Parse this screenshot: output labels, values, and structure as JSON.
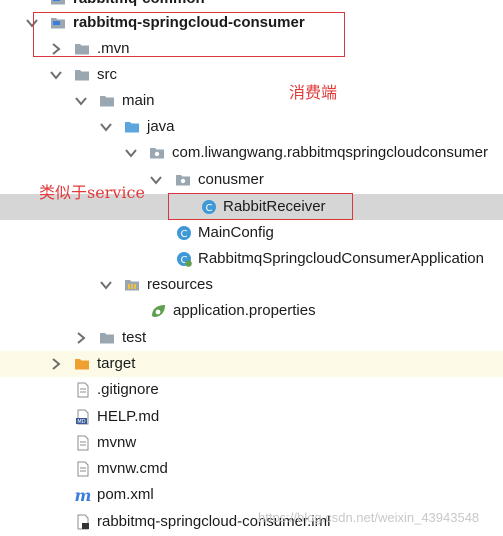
{
  "tree": {
    "top_cut_label": "rabbitmq-common",
    "project_label": "rabbitmq-springcloud-consumer",
    "mvn_label": ".mvn",
    "src_label": "src",
    "main_label": "main",
    "java_label": "java",
    "package_label": "com.liwangwang.rabbitmqspringcloudconsumer",
    "conusmer_label": "conusmer",
    "rabbit_receiver_label": "RabbitReceiver",
    "mainconfig_label": "MainConfig",
    "application_label": "RabbitmqSpringcloudConsumerApplication",
    "resources_label": "resources",
    "properties_label": "application.properties",
    "test_label": "test",
    "target_label": "target",
    "gitignore_label": ".gitignore",
    "help_label": "HELP.md",
    "mvnw_label": "mvnw",
    "mvnwcmd_label": "mvnw.cmd",
    "pom_label": "pom.xml",
    "iml_label": "rabbitmq-springcloud-consumer.iml"
  },
  "annotations": {
    "consumer_note": "消费端",
    "service_note": "类似于service"
  },
  "watermark": "https://blog.csdn.net/weixin_43943548",
  "colors": {
    "selection": "#d6d6d6",
    "highlight_row": "#fdfbe8",
    "annotation_red": "#e23a3a",
    "folder_gray": "#9aa7b0",
    "java_folder_blue": "#5aa6dd",
    "class_blue": "#3f99d6",
    "target_orange": "#f0a030",
    "spring_green": "#5fa04e",
    "maven_blue": "#3b7ddd"
  },
  "icons": {
    "arrow_expanded": "chevron-down-icon",
    "arrow_collapsed": "chevron-right-icon",
    "folder": "folder-icon",
    "source_folder": "source-folder-icon",
    "package": "package-icon",
    "class": "class-icon",
    "spring_app": "spring-boot-class-icon",
    "resources_folder": "resources-folder-icon",
    "properties": "spring-properties-icon",
    "excluded_folder": "excluded-folder-icon",
    "text_file": "text-file-icon",
    "markdown": "markdown-file-icon",
    "maven": "maven-pom-icon",
    "iml": "iml-module-icon"
  }
}
